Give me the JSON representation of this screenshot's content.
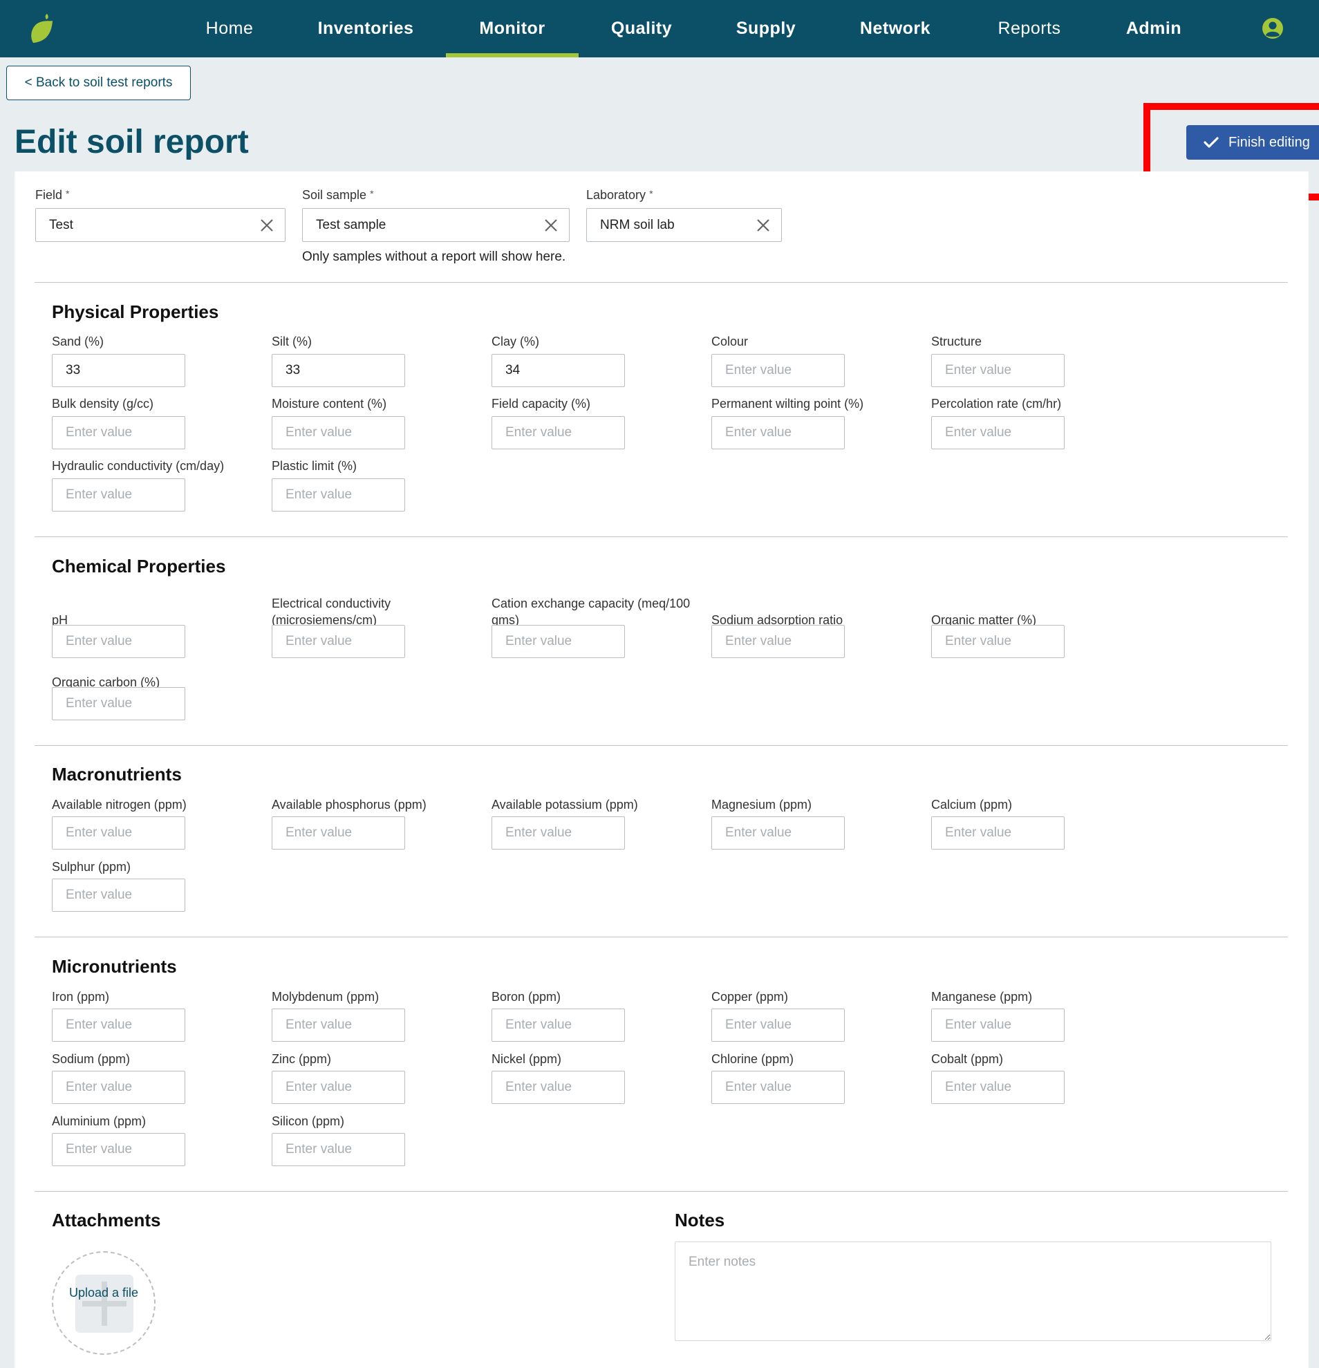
{
  "nav": {
    "items": [
      "Home",
      "Inventories",
      "Monitor",
      "Quality",
      "Supply",
      "Network",
      "Reports",
      "Admin"
    ],
    "active": "Monitor"
  },
  "icons": {
    "logo": "leaf-icon",
    "user": "user-circle-icon",
    "check": "check-icon",
    "clear": "close-icon",
    "upload": "plus-icon"
  },
  "colors": {
    "nav_bg": "#0b5066",
    "accent": "#a4c639",
    "primary_button": "#2e5aa6",
    "highlight": "#ff0000"
  },
  "back_button": "< Back to soil test reports",
  "page_title": "Edit soil report",
  "finish_button": "Finish editing",
  "top_fields": {
    "field": {
      "label": "Field",
      "value": "Test"
    },
    "soil_sample": {
      "label": "Soil sample",
      "value": "Test sample",
      "hint": "Only samples without a report will show here."
    },
    "laboratory": {
      "label": "Laboratory",
      "value": "NRM soil lab"
    },
    "required_mark": "*"
  },
  "placeholder": "Enter value",
  "sections": {
    "physical": {
      "title": "Physical Properties",
      "fields": [
        {
          "label": "Sand (%)",
          "value": "33"
        },
        {
          "label": "Silt (%)",
          "value": "33"
        },
        {
          "label": "Clay (%)",
          "value": "34"
        },
        {
          "label": "Colour",
          "value": ""
        },
        {
          "label": "Structure",
          "value": ""
        },
        {
          "label": "Bulk density (g/cc)",
          "value": ""
        },
        {
          "label": "Moisture content (%)",
          "value": ""
        },
        {
          "label": "Field capacity (%)",
          "value": ""
        },
        {
          "label": "Permanent wilting point (%)",
          "value": ""
        },
        {
          "label": "Percolation rate (cm/hr)",
          "value": ""
        },
        {
          "label": "Hydraulic conductivity (cm/day)",
          "value": ""
        },
        {
          "label": "Plastic limit (%)",
          "value": ""
        }
      ]
    },
    "chemical": {
      "title": "Chemical Properties",
      "fields": [
        {
          "label": "pH",
          "value": ""
        },
        {
          "label": "Electrical conductivity (microsiemens/cm)",
          "value": ""
        },
        {
          "label": "Cation exchange capacity (meq/100 gms)",
          "value": ""
        },
        {
          "label": "Sodium adsorption ratio",
          "value": ""
        },
        {
          "label": "Organic matter (%)",
          "value": ""
        },
        {
          "label": "Organic carbon (%)",
          "value": ""
        }
      ]
    },
    "macro": {
      "title": "Macronutrients",
      "fields": [
        {
          "label": "Available nitrogen (ppm)",
          "value": ""
        },
        {
          "label": "Available phosphorus (ppm)",
          "value": ""
        },
        {
          "label": "Available potassium (ppm)",
          "value": ""
        },
        {
          "label": "Magnesium (ppm)",
          "value": ""
        },
        {
          "label": "Calcium (ppm)",
          "value": ""
        },
        {
          "label": "Sulphur (ppm)",
          "value": ""
        }
      ]
    },
    "micro": {
      "title": "Micronutrients",
      "fields": [
        {
          "label": "Iron (ppm)",
          "value": ""
        },
        {
          "label": "Molybdenum (ppm)",
          "value": ""
        },
        {
          "label": "Boron (ppm)",
          "value": ""
        },
        {
          "label": "Copper (ppm)",
          "value": ""
        },
        {
          "label": "Manganese (ppm)",
          "value": ""
        },
        {
          "label": "Sodium (ppm)",
          "value": ""
        },
        {
          "label": "Zinc (ppm)",
          "value": ""
        },
        {
          "label": "Nickel (ppm)",
          "value": ""
        },
        {
          "label": "Chlorine (ppm)",
          "value": ""
        },
        {
          "label": "Cobalt (ppm)",
          "value": ""
        },
        {
          "label": "Aluminium (ppm)",
          "value": ""
        },
        {
          "label": "Silicon (ppm)",
          "value": ""
        }
      ]
    }
  },
  "attachments": {
    "title": "Attachments",
    "upload_label": "Upload a file"
  },
  "notes": {
    "title": "Notes",
    "placeholder": "Enter notes"
  }
}
